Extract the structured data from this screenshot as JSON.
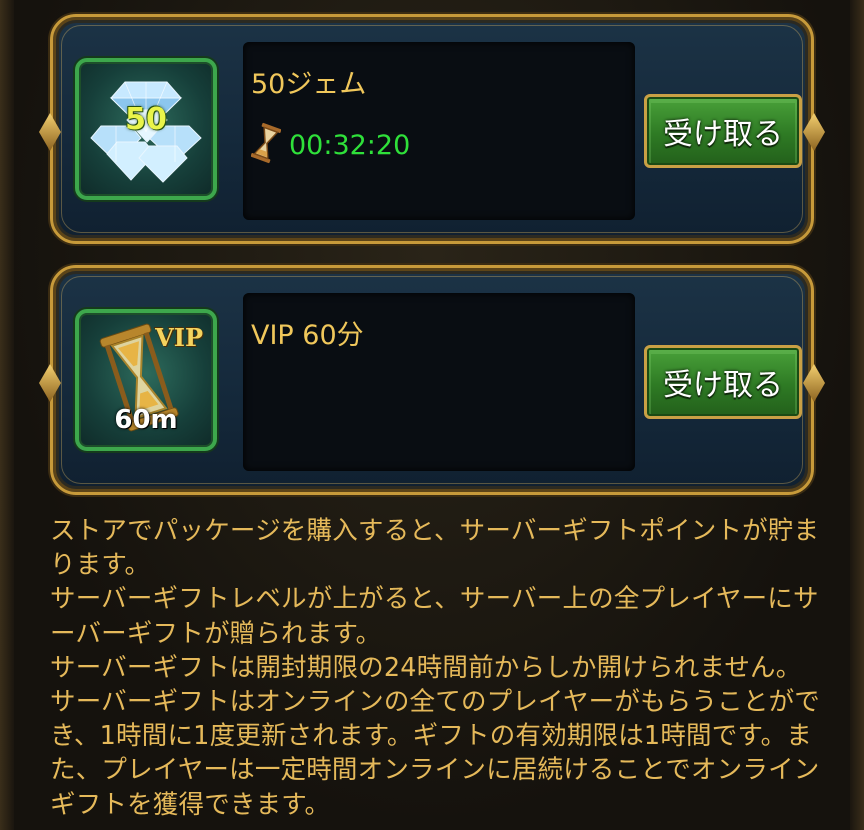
{
  "rewards": [
    {
      "title": "50ジェム",
      "icon": "diamond-gems-icon",
      "icon_badge": "50",
      "timer": "00:32:20",
      "timer_icon": "hourglass-icon",
      "claim_label": "受け取る"
    },
    {
      "title": "VIP 60分",
      "icon": "vip-hourglass-icon",
      "icon_badge_top": "VIP",
      "icon_badge_bottom": "60m",
      "claim_label": "受け取る"
    }
  ],
  "description": [
    "ストアでパッケージを購入すると、サーバーギフトポイントが貯まります。",
    "サーバーギフトレベルが上がると、サーバー上の全プレイヤーにサーバーギフトが贈られます。",
    "サーバーギフトは開封期限の24時間前からしか開けられません。サーバーギフトはオンラインの全てのプレイヤーがもらうことができ、1時間に1度更新されます。ギフトの有効期限は1時間です。また、プレイヤーは一定時間オンラインに居続けることでオンラインギフトを獲得できます。"
  ],
  "colors": {
    "gold_text": "#f0c75b",
    "timer_green": "#2fe03a",
    "button_green": "#2e7a24",
    "frame_gold": "#c79a3a"
  }
}
